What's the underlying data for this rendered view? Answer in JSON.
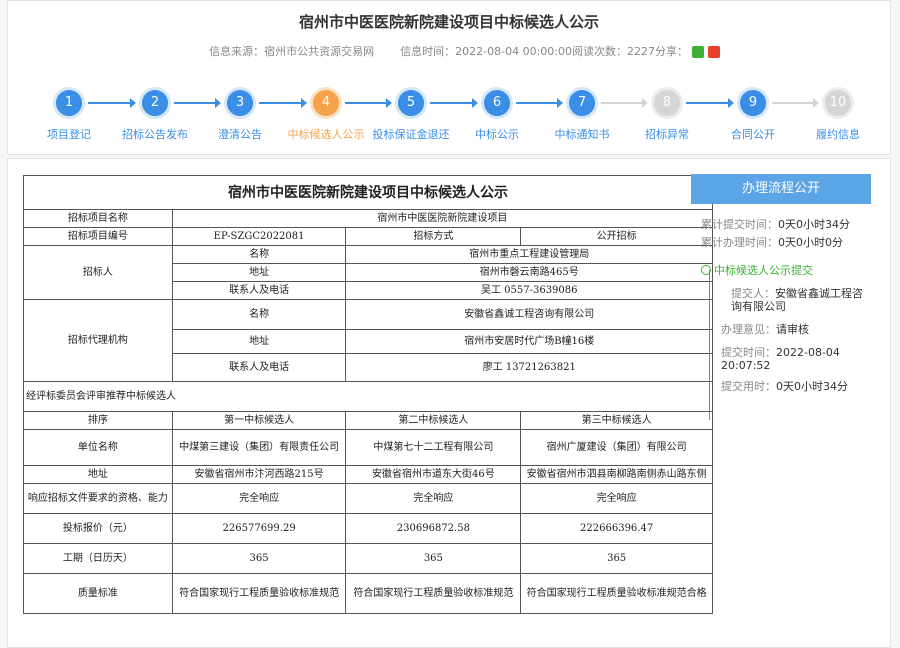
{
  "page": {
    "title": "宿州市中医医院新院建设项目中标候选人公示",
    "source_label": "信息来源：",
    "source": "宿州市公共资源交易网",
    "time_label": "信息时间：",
    "time": "2022-08-04 00:00:00",
    "views_label": "阅读次数：",
    "views": "2227",
    "share_label": "分享："
  },
  "steps": [
    {
      "num": "1",
      "label": "项目登记",
      "state": "done"
    },
    {
      "num": "2",
      "label": "招标公告发布",
      "state": "done"
    },
    {
      "num": "3",
      "label": "澄清公告",
      "state": "done"
    },
    {
      "num": "4",
      "label": "中标候选人公示",
      "state": "current"
    },
    {
      "num": "5",
      "label": "投标保证金退还",
      "state": "done"
    },
    {
      "num": "6",
      "label": "中标公示",
      "state": "done"
    },
    {
      "num": "7",
      "label": "中标通知书",
      "state": "done"
    },
    {
      "num": "8",
      "label": "招标异常",
      "state": "off"
    },
    {
      "num": "9",
      "label": "合同公开",
      "state": "done"
    },
    {
      "num": "10",
      "label": "履约信息",
      "state": "off"
    }
  ],
  "table": {
    "caption": "宿州市中医医院新院建设项目中标候选人公示",
    "l_name": "招标项目名称",
    "v_name": "宿州市中医医院新院建设项目",
    "l_code": "招标项目编号",
    "v_code": "EP-SZGC2022081",
    "l_method": "招标方式",
    "v_method": "公开招标",
    "l_tenderer": "招标人",
    "l_agent": "招标代理机构",
    "k_name": "名称",
    "k_addr": "地址",
    "k_contact": "联系人及电话",
    "t_name": "宿州市重点工程建设管理局",
    "t_addr": "宿州市磬云南路465号",
    "t_contact": "吴工  0557-3639086",
    "a_name": "安徽省鑫诚工程咨询有限公司",
    "a_addr": "宿州市安居时代广场B幢16楼",
    "a_contact": "廖工  13721263821",
    "review": "经评标委员会评审推荐中标候选人",
    "l_rank": "排序",
    "rank1": "第一中标候选人",
    "rank2": "第二中标候选人",
    "rank3": "第三中标候选人",
    "l_unit": "单位名称",
    "u1": "中煤第三建设（集团）有限责任公司",
    "u2": "中煤第七十二工程有限公司",
    "u3": "宿州广厦建设（集团）有限公司",
    "l_addr": "地址",
    "ad1": "安徽省宿州市汴河西路215号",
    "ad2": "安徽省宿州市道东大街46号",
    "ad3": "安徽省宿州市泗县南柳路南侧赤山路东侧",
    "l_resp": "响应招标文件要求的资格、能力",
    "r1": "完全响应",
    "r2": "完全响应",
    "r3": "完全响应",
    "l_price": "投标报价（元）",
    "p1": "226577699.29",
    "p2": "230696872.58",
    "p3": "222666396.47",
    "l_period": "工期（日历天）",
    "d1": "365",
    "d2": "365",
    "d3": "365",
    "l_quality": "质量标准",
    "q1": "符合国家现行工程质量验收标准规范",
    "q2": "符合国家现行工程质量验收标准规范",
    "q3": "符合国家现行工程质量验收标准规范合格"
  },
  "panel": {
    "title": "办理流程公开",
    "submit_label": "累计提交时间：",
    "submit_value": "0天0小时34分",
    "handle_label": "累计办理时间：",
    "handle_value": "0天0小时0分",
    "stage": "中标候选人公示提交",
    "submitter_label": "提交人：",
    "submitter": "安徽省鑫诚工程咨询有限公司",
    "opinion_label": "办理意见：",
    "opinion": "请审核",
    "stime_label": "提交时间：",
    "stime": "2022-08-04 20:07:52",
    "cost_label": "提交用时：",
    "cost": "0天0小时34分"
  }
}
